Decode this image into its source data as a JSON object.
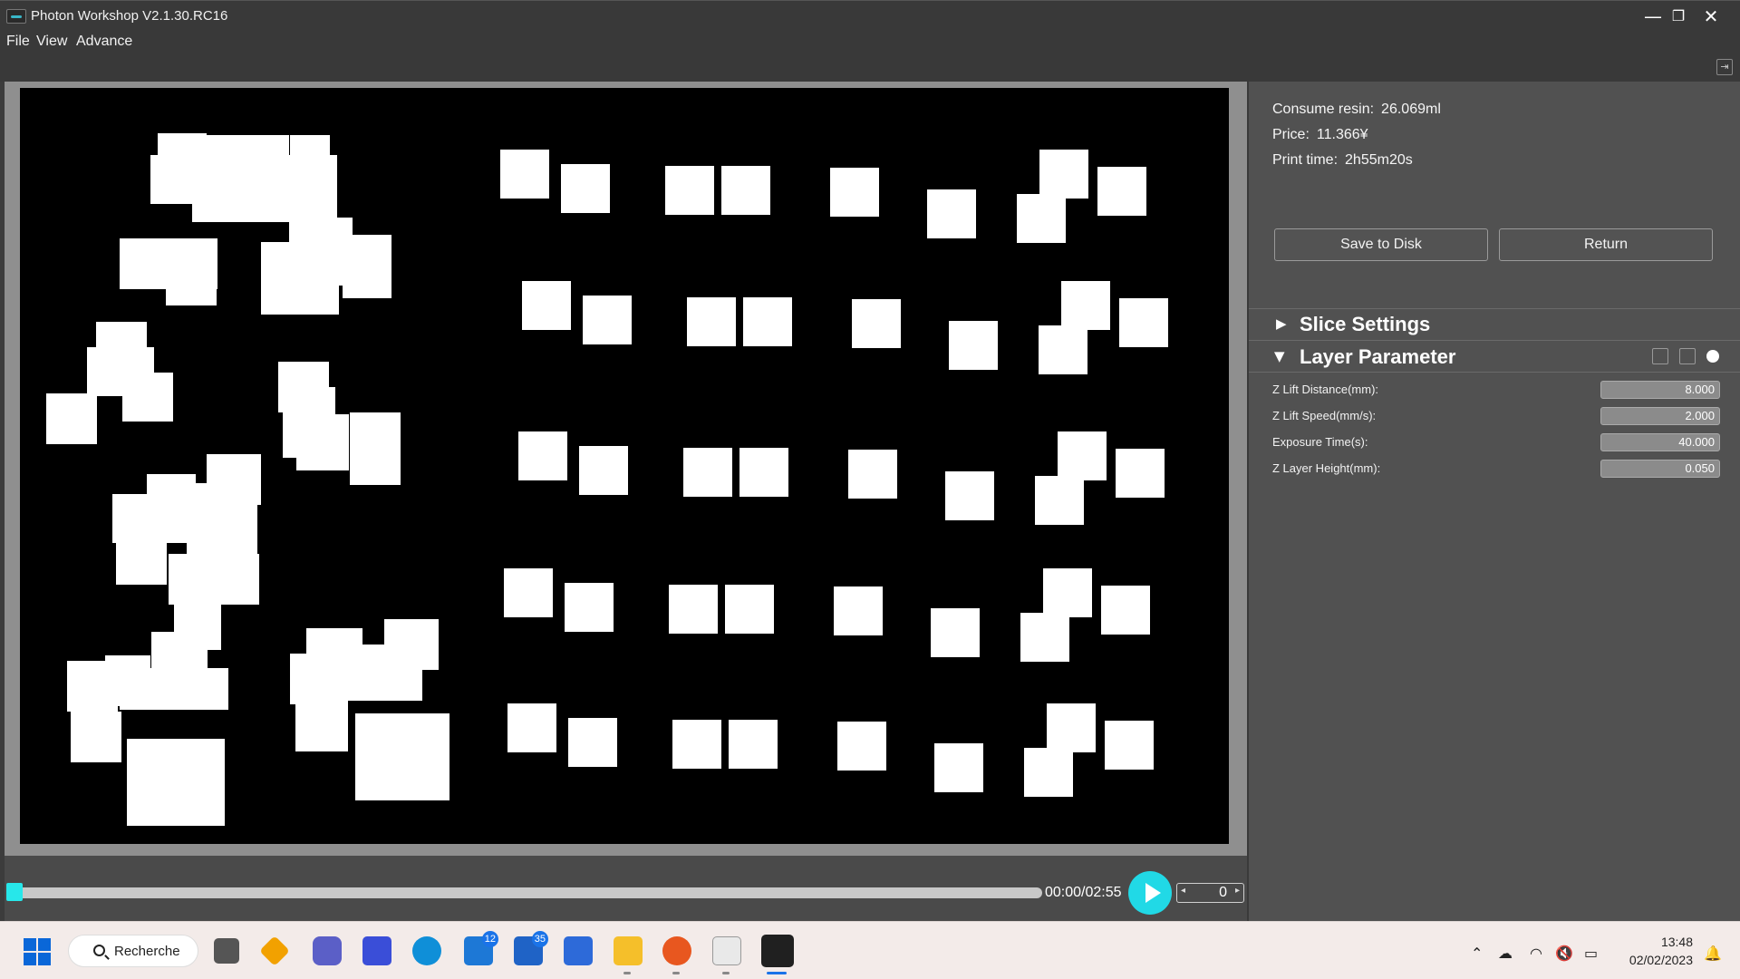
{
  "window": {
    "title": "Photon Workshop V2.1.30.RC16",
    "minimize_glyph": "—",
    "restore_glyph": "❐",
    "close_glyph": "✕"
  },
  "menu": [
    "File",
    "View",
    "Advance"
  ],
  "preview": {
    "background": "#000000",
    "shape_color": "#ffffff"
  },
  "playback": {
    "time": "00:00/02:55",
    "layer": "0",
    "accent": "#21d9e6"
  },
  "info": {
    "resin_label": "Consume resin:",
    "resin_value": "26.069ml",
    "price_label": "Price:",
    "price_value": "11.366¥",
    "time_label": "Print time:",
    "time_value": "2h55m20s"
  },
  "buttons": {
    "save": "Save to Disk",
    "return": "Return"
  },
  "sections": {
    "slice": "Slice Settings",
    "layer": "Layer Parameter"
  },
  "params": [
    {
      "label": "Z Lift Distance(mm):",
      "value": "8.000"
    },
    {
      "label": "Z Lift Speed(mm/s):",
      "value": "2.000"
    },
    {
      "label": "Exposure Time(s):",
      "value": "40.000"
    },
    {
      "label": "Z Layer Height(mm):",
      "value": "0.050"
    }
  ],
  "taskbar": {
    "search": "Recherche",
    "mail_badge": "12",
    "teams_badge": "35",
    "time": "13:48",
    "date": "02/02/2023"
  }
}
